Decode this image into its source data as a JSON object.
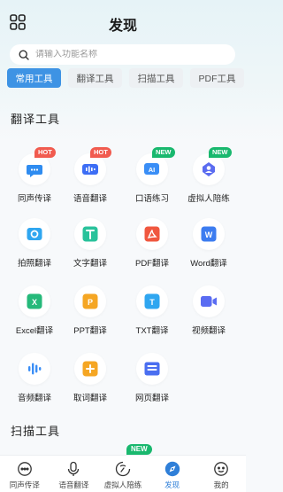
{
  "header": {
    "title": "发现",
    "menu_icon": "grid-icon"
  },
  "search": {
    "placeholder": "请输入功能名称",
    "value": ""
  },
  "tabs": [
    {
      "label": "常用工具",
      "active": true
    },
    {
      "label": "翻译工具",
      "active": false
    },
    {
      "label": "扫描工具",
      "active": false
    },
    {
      "label": "PDF工具",
      "active": false
    }
  ],
  "sections": {
    "translate": {
      "title": "翻译工具"
    },
    "scan": {
      "title": "扫描工具"
    }
  },
  "tools": [
    {
      "label": "同声传译",
      "icon": "chat-bubble-icon",
      "badge": "HOT",
      "color": "#2f8cf0"
    },
    {
      "label": "语音翻译",
      "icon": "voice-wave-icon",
      "badge": "HOT",
      "color": "#3d6ef5"
    },
    {
      "label": "口语练习",
      "icon": "ai-chat-icon",
      "badge": "NEW",
      "color": "#3a8ef6"
    },
    {
      "label": "虚拟人陪练",
      "icon": "virtual-human-icon",
      "badge": "NEW",
      "color": "#5b6cf0"
    },
    {
      "label": "拍照翻译",
      "icon": "camera-icon",
      "badge": "",
      "color": "#2fa6f0"
    },
    {
      "label": "文字翻译",
      "icon": "text-icon",
      "badge": "",
      "color": "#29c29b"
    },
    {
      "label": "PDF翻译",
      "icon": "pdf-icon",
      "badge": "",
      "color": "#f0573f"
    },
    {
      "label": "Word翻译",
      "icon": "word-icon",
      "badge": "",
      "color": "#3c7cf0"
    },
    {
      "label": "Excel翻译",
      "icon": "excel-icon",
      "badge": "",
      "color": "#25b97a"
    },
    {
      "label": "PPT翻译",
      "icon": "ppt-icon",
      "badge": "",
      "color": "#f5a623"
    },
    {
      "label": "TXT翻译",
      "icon": "txt-icon",
      "badge": "",
      "color": "#2fa6f0"
    },
    {
      "label": "视频翻译",
      "icon": "video-icon",
      "badge": "",
      "color": "#5a6cf2"
    },
    {
      "label": "音频翻译",
      "icon": "audio-wave-icon",
      "badge": "",
      "color": "#3a8ef6"
    },
    {
      "label": "取词翻译",
      "icon": "pick-word-icon",
      "badge": "",
      "color": "#f5a623"
    },
    {
      "label": "网页翻译",
      "icon": "webpage-icon",
      "badge": "",
      "color": "#4a6ef0"
    }
  ],
  "bottom_nav": [
    {
      "label": "同声传译",
      "icon": "chat-icon",
      "active": false
    },
    {
      "label": "语音翻译",
      "icon": "microphone-icon",
      "active": false
    },
    {
      "label": "虚拟人陪练",
      "icon": "virtual-human-icon",
      "active": false,
      "badge": "NEW"
    },
    {
      "label": "发现",
      "icon": "compass-icon",
      "active": true
    },
    {
      "label": "我的",
      "icon": "face-icon",
      "active": false
    }
  ]
}
